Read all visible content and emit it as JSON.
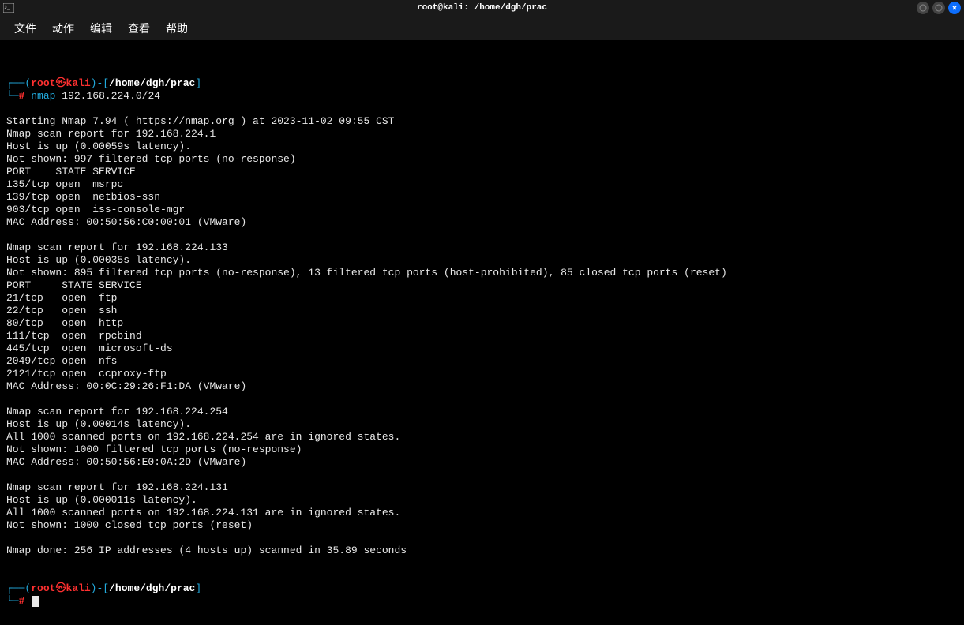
{
  "titlebar": {
    "title": "root@kali: /home/dgh/prac"
  },
  "menu": {
    "items": [
      "文件",
      "动作",
      "编辑",
      "查看",
      "帮助"
    ]
  },
  "prompt1": {
    "user": "root",
    "skull": "㉿",
    "host": "kali",
    "cwd": "/home/dgh/prac",
    "hash": "#",
    "cmd": "nmap",
    "args": "192.168.224.0/24"
  },
  "output_lines": [
    "Starting Nmap 7.94 ( https://nmap.org ) at 2023-11-02 09:55 CST",
    "Nmap scan report for 192.168.224.1",
    "Host is up (0.00059s latency).",
    "Not shown: 997 filtered tcp ports (no-response)",
    "PORT    STATE SERVICE",
    "135/tcp open  msrpc",
    "139/tcp open  netbios-ssn",
    "903/tcp open  iss-console-mgr",
    "MAC Address: 00:50:56:C0:00:01 (VMware)",
    "",
    "Nmap scan report for 192.168.224.133",
    "Host is up (0.00035s latency).",
    "Not shown: 895 filtered tcp ports (no-response), 13 filtered tcp ports (host-prohibited), 85 closed tcp ports (reset)",
    "PORT     STATE SERVICE",
    "21/tcp   open  ftp",
    "22/tcp   open  ssh",
    "80/tcp   open  http",
    "111/tcp  open  rpcbind",
    "445/tcp  open  microsoft-ds",
    "2049/tcp open  nfs",
    "2121/tcp open  ccproxy-ftp",
    "MAC Address: 00:0C:29:26:F1:DA (VMware)",
    "",
    "Nmap scan report for 192.168.224.254",
    "Host is up (0.00014s latency).",
    "All 1000 scanned ports on 192.168.224.254 are in ignored states.",
    "Not shown: 1000 filtered tcp ports (no-response)",
    "MAC Address: 00:50:56:E0:0A:2D (VMware)",
    "",
    "Nmap scan report for 192.168.224.131",
    "Host is up (0.000011s latency).",
    "All 1000 scanned ports on 192.168.224.131 are in ignored states.",
    "Not shown: 1000 closed tcp ports (reset)",
    "",
    "Nmap done: 256 IP addresses (4 hosts up) scanned in 35.89 seconds"
  ],
  "prompt2": {
    "user": "root",
    "skull": "㉿",
    "host": "kali",
    "cwd": "/home/dgh/prac",
    "hash": "#"
  }
}
